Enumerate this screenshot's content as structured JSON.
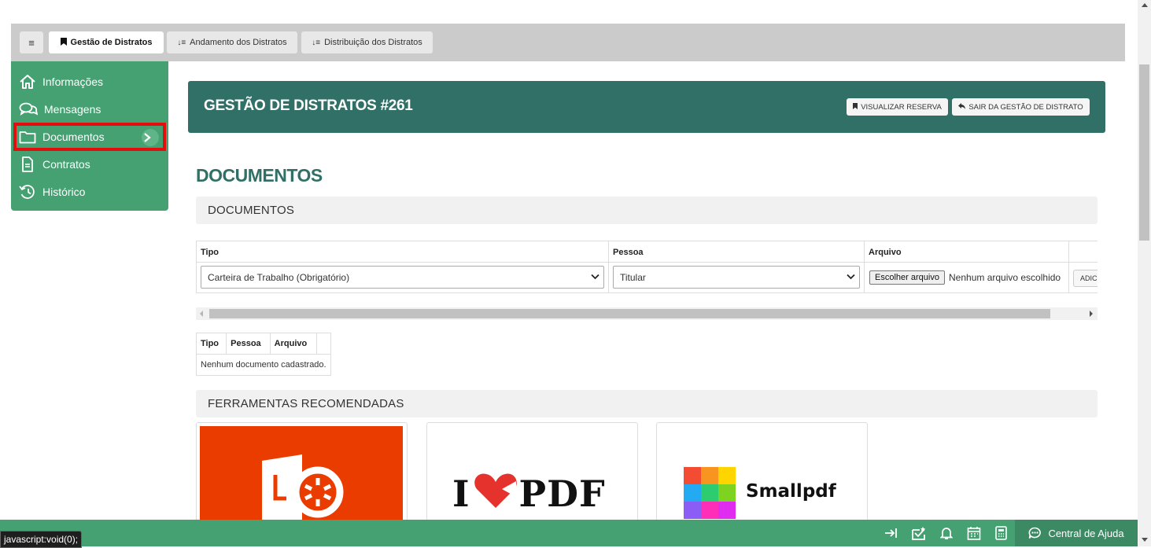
{
  "tabs": [
    {
      "label": "Gestão de Distratos",
      "active": true
    },
    {
      "label": "Andamento dos Distratos",
      "active": false
    },
    {
      "label": "Distribuição dos Distratos",
      "active": false
    }
  ],
  "menu_button_label": "≡",
  "sidebar": {
    "items": [
      {
        "label": "Informações",
        "icon": "home-icon"
      },
      {
        "label": "Mensagens",
        "icon": "chat-icon"
      },
      {
        "label": "Documentos",
        "icon": "folder-icon",
        "selected": true
      },
      {
        "label": "Contratos",
        "icon": "file-text-icon"
      },
      {
        "label": "Histórico",
        "icon": "history-icon"
      }
    ]
  },
  "header": {
    "title": "GESTÃO DE DISTRATOS #261",
    "view_reservation_label": "VISUALIZAR RESERVA",
    "exit_label": "SAIR DA GESTÃO DE DISTRATO"
  },
  "section_title": "DOCUMENTOS",
  "documents_panel_title": "DOCUMENTOS",
  "upload_table": {
    "headers": [
      "Tipo",
      "Pessoa",
      "Arquivo"
    ],
    "tipo_value": "Carteira de Trabalho (Obrigatório)",
    "pessoa_value": "Titular",
    "file_button_label": "Escolher arquivo",
    "file_status": "Nenhum arquivo escolhido",
    "add_button_label": "ADIC"
  },
  "documents_table": {
    "headers": [
      "Tipo",
      "Pessoa",
      "Arquivo"
    ],
    "empty_message": "Nenhum documento cadastrado."
  },
  "tools_panel_title": "FERRAMENTAS RECOMENDADAS",
  "tools": [
    {
      "name": "Office Lens",
      "icon": "office-lens-logo"
    },
    {
      "name": "I PDF",
      "text_left": "I",
      "text_right": "PDF",
      "icon": "ilovepdf-logo"
    },
    {
      "name": "Smallpdf",
      "icon": "smallpdf-logo"
    }
  ],
  "bottom_bar": {
    "help_label": "Central de Ajuda"
  },
  "status_url": "javascript:void(0);",
  "colors": {
    "brand_green": "#45a072",
    "header_teal": "#307066",
    "selection_red": "#e40c0c"
  }
}
